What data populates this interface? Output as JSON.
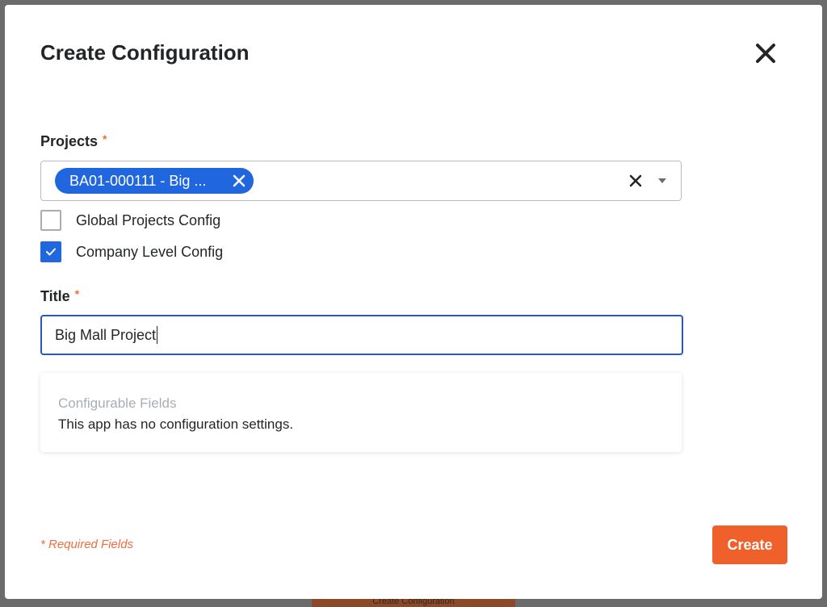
{
  "modal": {
    "title": "Create Configuration"
  },
  "projects": {
    "label": "Projects",
    "required_mark": "*",
    "selected_chip": "BA01-000111 - Big ..."
  },
  "checkboxes": [
    {
      "label": "Global Projects Config",
      "checked": false
    },
    {
      "label": "Company Level Config",
      "checked": true
    }
  ],
  "title_field": {
    "label": "Title",
    "required_mark": "*",
    "value": "Big Mall Project"
  },
  "configurable": {
    "heading": "Configurable Fields",
    "message": "This app has no configuration settings."
  },
  "footer": {
    "required_note": "* Required Fields",
    "create_label": "Create"
  },
  "background": {
    "partial_button_text": "Create Configuration"
  },
  "colors": {
    "accent_blue": "#2066df",
    "accent_orange": "#f0602b",
    "focus_border": "#2a57b8"
  },
  "icons": {
    "close": "close-icon",
    "chip_remove": "close-icon",
    "clear": "clear-icon",
    "dropdown": "chevron-down-icon",
    "check": "checkmark-icon"
  }
}
